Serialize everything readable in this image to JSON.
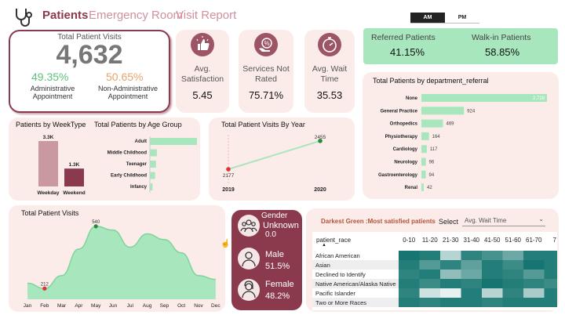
{
  "header": {
    "nav": [
      "Patients",
      "Emergency Room",
      "Visit Report"
    ],
    "toggle": [
      "AM",
      "PM"
    ]
  },
  "kpi": {
    "total_label": "Total Patient Visits",
    "total_value": "4,632",
    "admin_pct": "49.35%",
    "admin_label_1": "Administrative",
    "admin_label_2": "Appointment",
    "nonadmin_pct": "50.65%",
    "nonadmin_label_1": "Non-Administrative",
    "nonadmin_label_2": "Appointment",
    "satisfaction_label_1": "Avg.",
    "satisfaction_label_2": "Satisfaction",
    "satisfaction_value": "5.45",
    "notrated_label_1": "Services Not",
    "notrated_label_2": "Rated",
    "notrated_value": "75.71%",
    "wait_label_1": "Avg. Wait",
    "wait_label_2": "Time",
    "wait_value": "35.53",
    "referred_label": "Referred Patients",
    "referred_value": "41.15%",
    "walkin_label": "Walk-in Patients",
    "walkin_value": "58.85%"
  },
  "gender": {
    "title": "Gender",
    "items": [
      {
        "label": "Unknown",
        "value": "0.0"
      },
      {
        "label": "Male",
        "value": "51.5%"
      },
      {
        "label": "Female",
        "value": "48.2%"
      }
    ]
  },
  "heatmap": {
    "title": "Darkest Green :Most satisfied patients",
    "select_label": "Select",
    "select_value": "Avg. Wait Time",
    "row_header": "patient_race"
  },
  "chart_data": [
    {
      "type": "bar",
      "title": "Total Patients by department_referral",
      "orientation": "horizontal",
      "categories": [
        "None",
        "General Practice",
        "Orthopedics",
        "Physiotherapy",
        "Cardiology",
        "Neurology",
        "Gastroenterology",
        "Renal"
      ],
      "values": [
        2728,
        924,
        469,
        164,
        117,
        96,
        94,
        42
      ],
      "labels": [
        "2,728",
        "924",
        "469",
        "164",
        "117",
        "96",
        "94",
        "42"
      ],
      "color": "#a8e6bd"
    },
    {
      "type": "bar",
      "title": "Patients by WeekType",
      "categories": [
        "Weekday",
        "Weekend"
      ],
      "values": [
        3300,
        1300
      ],
      "labels": [
        "3.3K",
        "1.3K"
      ],
      "colors": [
        "#c9999f",
        "#8b3a4e"
      ]
    },
    {
      "type": "bar",
      "title": "Total Patients by Age Group",
      "orientation": "horizontal",
      "categories": [
        "Adult",
        "Middle Childhood",
        "Teenager",
        "Early Childhood",
        "Infancy"
      ],
      "values": [
        2700,
        400,
        350,
        300,
        150
      ],
      "color": "#a8e6bd"
    },
    {
      "type": "line",
      "title": "Total Patient Visits By Year",
      "x": [
        "2019",
        "2020"
      ],
      "values": [
        2177,
        2455
      ],
      "labels": [
        "2177",
        "2455"
      ]
    },
    {
      "type": "area",
      "title": "Total Patient Visits",
      "x": [
        "Jan",
        "Feb",
        "Mar",
        "Apr",
        "May",
        "Jun",
        "Jul",
        "Aug",
        "Sep",
        "Oct",
        "Nov",
        "Dec"
      ],
      "values": [
        240,
        212,
        280,
        420,
        540,
        520,
        430,
        500,
        470,
        400,
        280,
        260
      ],
      "annotations": [
        {
          "x": "Feb",
          "label": "212"
        },
        {
          "x": "May",
          "label": "540"
        }
      ]
    },
    {
      "type": "heatmap",
      "columns": [
        "0-10",
        "11-20",
        "21-30",
        "31-40",
        "41-50",
        "51-60",
        "61-70",
        "7"
      ],
      "rows": [
        "African American",
        "Asian",
        "Declined to Identify",
        "Native American/Alaska Native",
        "Pacific Islander",
        "Two or More Races"
      ],
      "values": [
        [
          0.95,
          0.9,
          0.3,
          0.85,
          0.75,
          0.6,
          0.9,
          0.9
        ],
        [
          0.9,
          0.7,
          0.85,
          0.65,
          0.9,
          0.8,
          0.95,
          0.9
        ],
        [
          0.85,
          0.9,
          0.45,
          0.6,
          0.9,
          0.85,
          0.7,
          0.9
        ],
        [
          0.9,
          0.8,
          0.9,
          0.85,
          0.95,
          0.9,
          0.85,
          0.8
        ],
        [
          0.85,
          0.2,
          0.1,
          0.9,
          0.3,
          0.85,
          0.35,
          0.9
        ],
        [
          0.9,
          0.85,
          0.9,
          0.9,
          0.85,
          0.9,
          0.9,
          0.9
        ]
      ]
    }
  ]
}
